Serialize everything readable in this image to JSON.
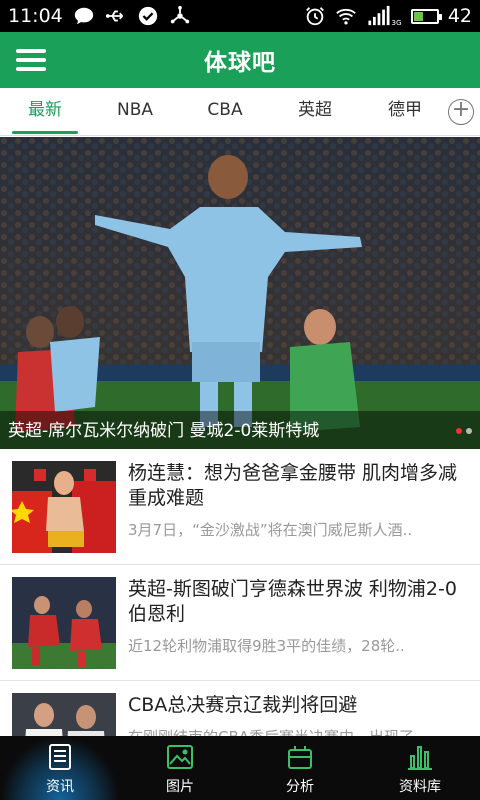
{
  "status_bar": {
    "time": "11:04",
    "battery_level": "42",
    "network_type": "3G",
    "icons": [
      "chat-icon",
      "usb-icon",
      "check-circle-icon",
      "usb-tether-icon",
      "alarm-icon",
      "wifi-icon",
      "signal-icon",
      "battery-icon"
    ]
  },
  "app_bar": {
    "title": "体球吧",
    "menu_icon": "hamburger-menu-icon"
  },
  "tabs": [
    {
      "label": "最新",
      "active": true
    },
    {
      "label": "NBA"
    },
    {
      "label": "CBA"
    },
    {
      "label": "英超"
    },
    {
      "label": "德甲"
    }
  ],
  "tab_add_icon": "plus-circle-icon",
  "hero": {
    "caption": "英超-席尔瓦米尔纳破门 曼城2-0莱斯特城",
    "slide_count": 2,
    "active_slide": 1
  },
  "news": [
    {
      "title": "杨连慧：想为爸爸拿金腰带 肌肉增多减重成难题",
      "summary": "3月7日，“金沙激战”将在澳门威尼斯人酒.."
    },
    {
      "title": "英超-斯图破门亨德森世界波 利物浦2-0伯恩利",
      "summary": "近12轮利物浦取得9胜3平的佳绩，28轮.."
    },
    {
      "title": "CBA总决赛京辽裁判将回避",
      "summary": "在刚刚结束的CBA季后赛半决赛中，出现了.."
    }
  ],
  "bottom_nav": [
    {
      "label": "资讯",
      "icon": "news-icon",
      "active": true
    },
    {
      "label": "图片",
      "icon": "image-icon"
    },
    {
      "label": "分析",
      "icon": "analysis-icon"
    },
    {
      "label": "资料库",
      "icon": "database-chart-icon"
    }
  ],
  "colors": {
    "primary": "#1aa058",
    "nav_bg": "#0b0b0b",
    "active_nav_glow": "#14639a"
  }
}
